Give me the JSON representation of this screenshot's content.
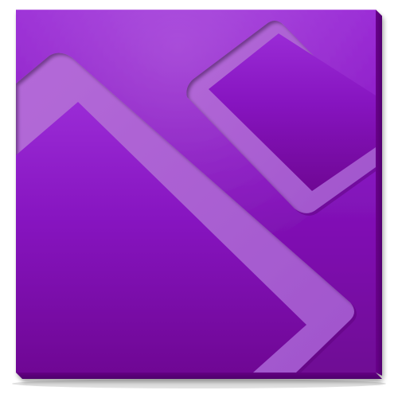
{
  "icon": {
    "name": "purple-tile-app-icon",
    "colors": {
      "face_light": "#9a2bd6",
      "face_mid": "#8614bf",
      "face_dark": "#6f0794",
      "edge": "#5c0079",
      "panel_light": "#b46ad8",
      "panel_mid": "#a657cf",
      "groove_shadow": "#4a0063"
    }
  }
}
